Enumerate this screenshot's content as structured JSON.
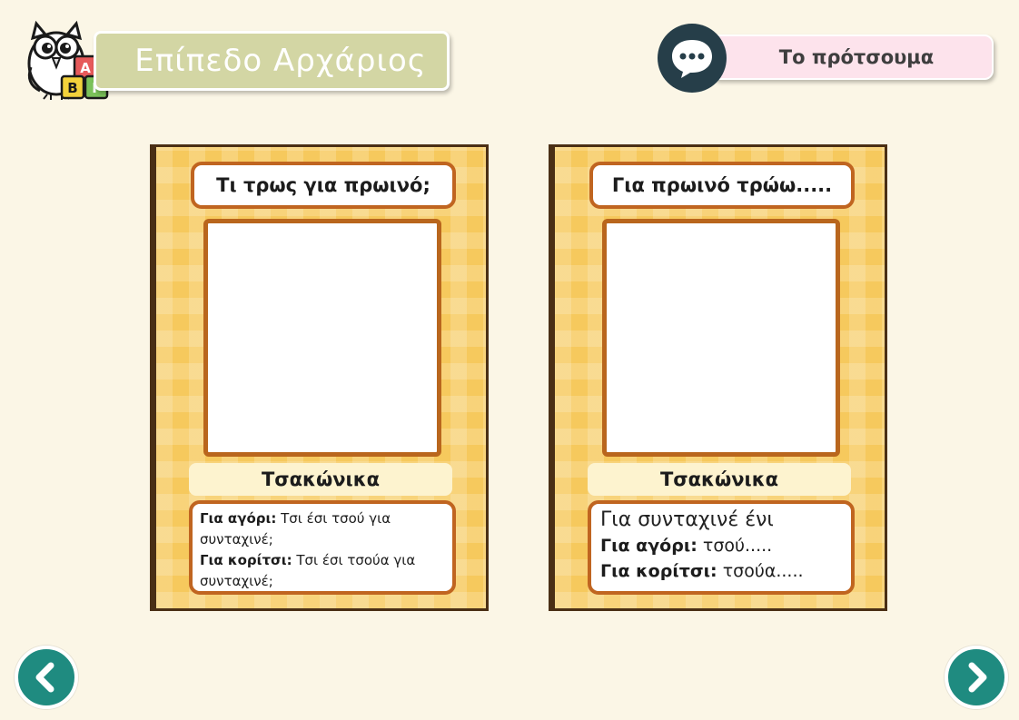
{
  "header": {
    "level_title": "Επίπεδο Αρχάριος",
    "logo_blocks": [
      "Α",
      "Β",
      "Γ"
    ],
    "suggestion_label": "Το πρότσουμα"
  },
  "cards": [
    {
      "title": "Τι τρως για πρωινό;",
      "language": "Τσακώνικα",
      "boy_label": "Για αγόρι:",
      "boy_text": "Τσι έσι τσού για συνταχινέ;",
      "girl_label": "Για κορίτσι:",
      "girl_text": "Τσι έσι τσούα για συνταχινέ;"
    },
    {
      "title": "Για πρωινό τρώω.....",
      "language": "Τσακώνικα",
      "intro": "Για συνταχινέ ένι",
      "boy_label": "Για αγόρι:",
      "boy_text": "τσού.....",
      "girl_label": "Για κορίτσι:",
      "girl_text": "τσούα....."
    }
  ],
  "navigation": {
    "prev_icon": "chevron-left-icon",
    "next_icon": "chevron-right-icon"
  },
  "colors": {
    "background": "#fbf6e6",
    "card": "#f6c95d",
    "card_border": "#c06520",
    "nav": "#1f8b80",
    "chat": "#263e49",
    "level_banner": "#d3d6a4",
    "suggestion_pill": "#fde3ec"
  }
}
